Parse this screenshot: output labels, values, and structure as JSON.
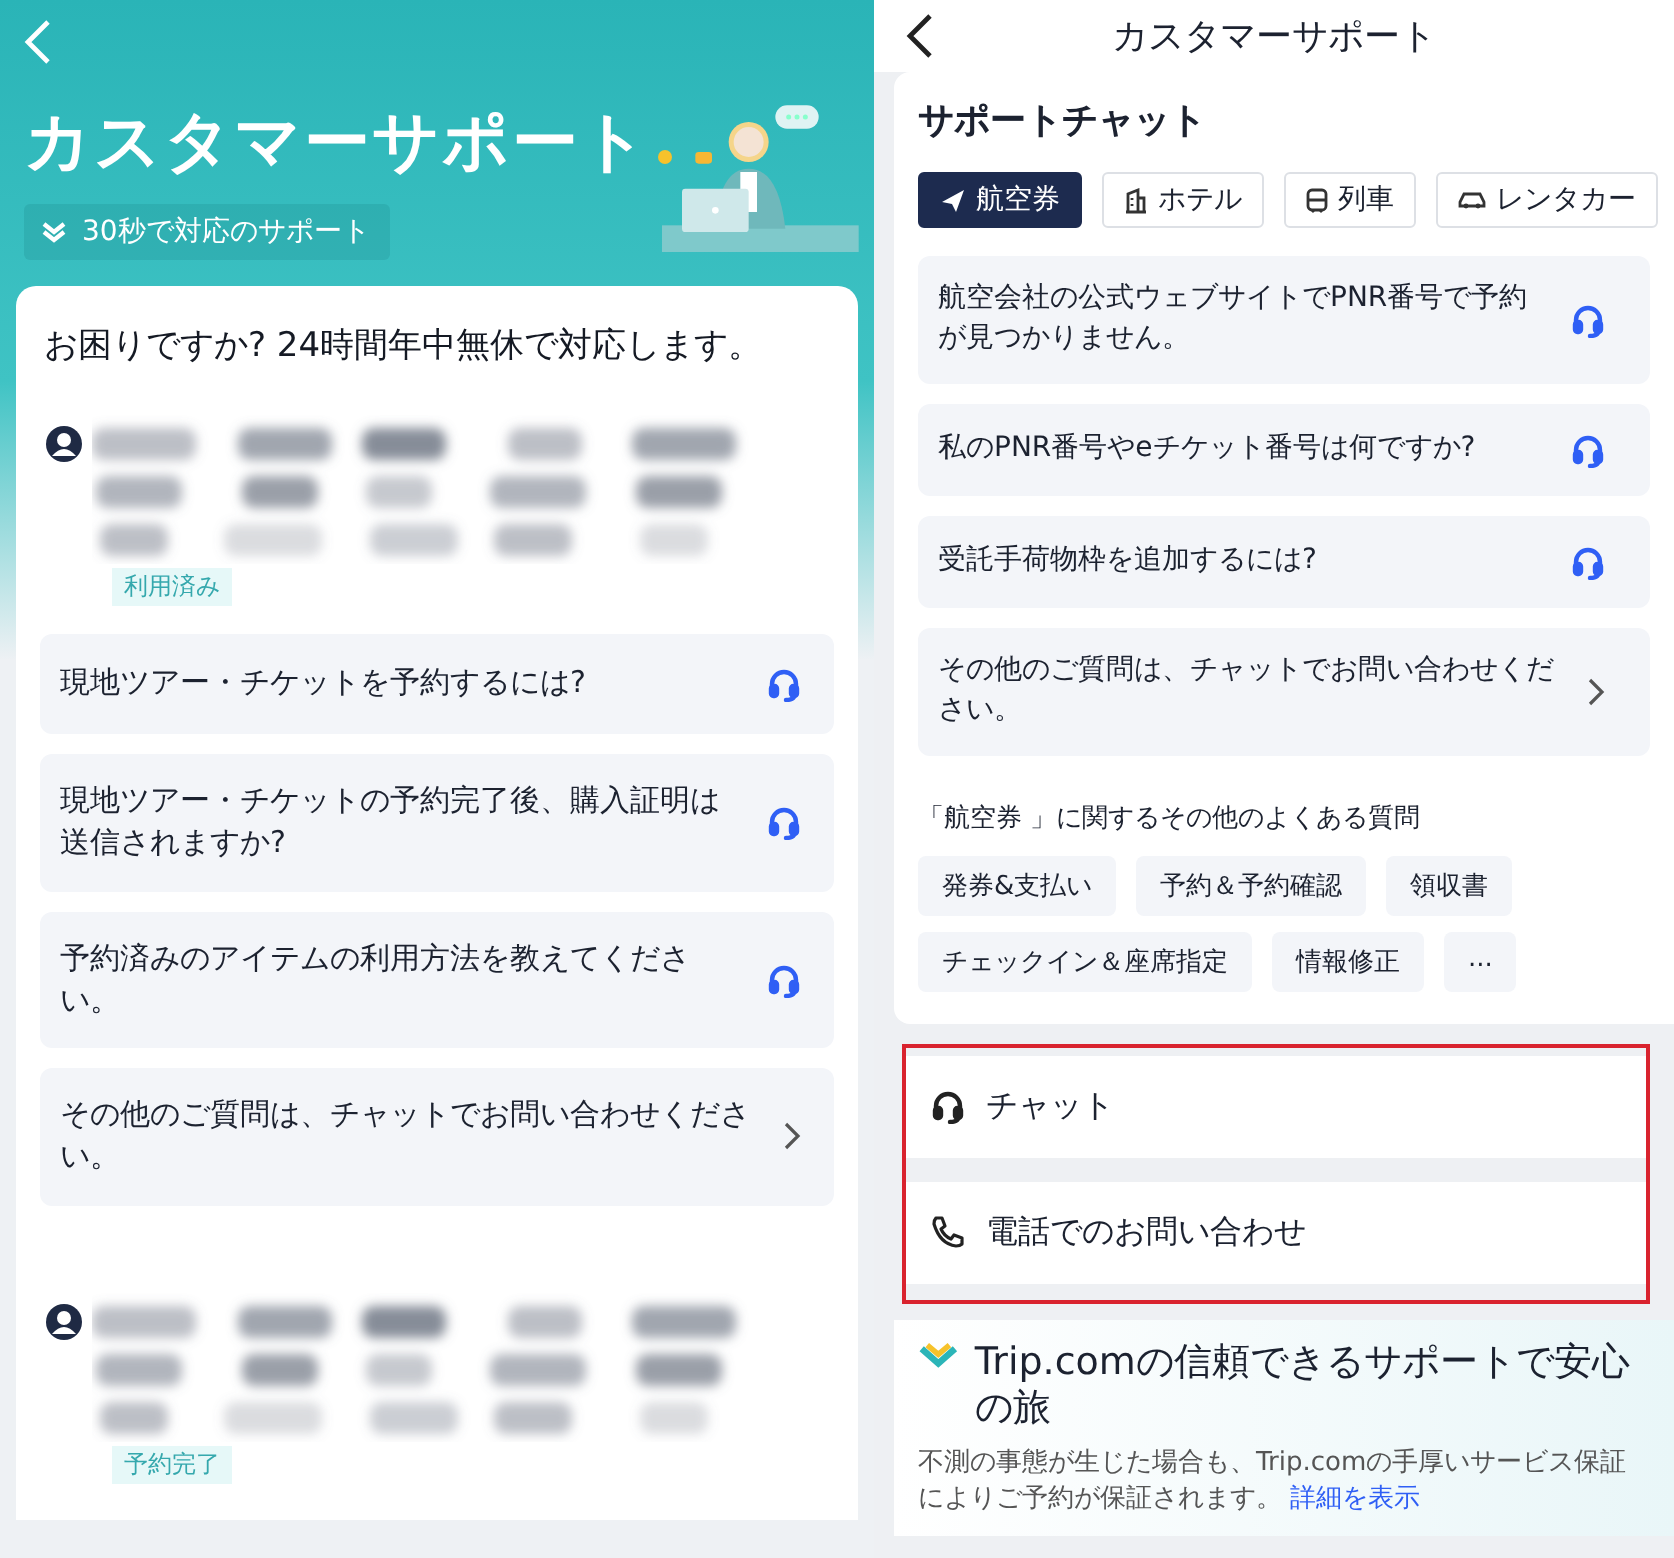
{
  "left_screen": {
    "title": "カスタマーサポート",
    "badge": "30秒で対応のサポート",
    "greeting": "お困りですか? 24時間年中無休で対応します。",
    "bookings": [
      {
        "status": "利用済み",
        "faqs": [
          {
            "text": "現地ツアー・チケットを予約するには?",
            "kind": "chat"
          },
          {
            "text": "現地ツアー・チケットの予約完了後、購入証明は送信されますか?",
            "kind": "chat"
          },
          {
            "text": "予約済みのアイテムの利用方法を教えてください。",
            "kind": "chat"
          },
          {
            "text": "その他のご質問は、チャットでお問い合わせください。",
            "kind": "more"
          }
        ]
      },
      {
        "status": "予約完了"
      }
    ]
  },
  "right_screen": {
    "title": "カスタマーサポート",
    "section_title": "サポートチャット",
    "tabs": [
      {
        "label": "航空券",
        "kind": "flight",
        "selected": true
      },
      {
        "label": "ホテル",
        "kind": "hotel",
        "selected": false
      },
      {
        "label": "列車",
        "kind": "train",
        "selected": false
      },
      {
        "label": "レンタカー",
        "kind": "car",
        "selected": false
      }
    ],
    "faqs": [
      {
        "text": "航空会社の公式ウェブサイトでPNR番号で予約が見つかりません。",
        "kind": "chat"
      },
      {
        "text": "私のPNR番号やeチケット番号は何ですか?",
        "kind": "chat"
      },
      {
        "text": "受託手荷物枠を追加するには?",
        "kind": "chat"
      },
      {
        "text": "その他のご質問は、チャットでお問い合わせください。",
        "kind": "more"
      }
    ],
    "related_heading": "「航空券 」に関するその他のよくある質問",
    "topics": [
      "発券&支払い",
      "予約＆予約確認",
      "領収書",
      "チェックイン＆座席指定",
      "情報修正",
      "..."
    ],
    "contacts": [
      {
        "label": "チャット",
        "kind": "chat"
      },
      {
        "label": "電話でのお問い合わせ",
        "kind": "phone"
      }
    ],
    "trust": {
      "title": "Trip.comの信頼できるサポートで安心の旅",
      "body": "不測の事態が生じた場合も、Trip.comの手厚いサービス保証によりご予約が保証されます。",
      "link": "詳細を表示"
    }
  }
}
